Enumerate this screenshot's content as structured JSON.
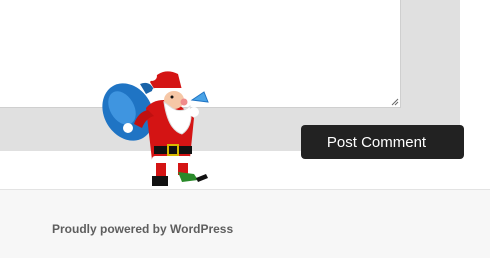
{
  "comment_form": {
    "comment_value": "",
    "submit_label": "Post Comment"
  },
  "decoration": {
    "name": "santa-claus"
  },
  "footer": {
    "credit": "Proudly powered by WordPress"
  },
  "colors": {
    "form_background": "#e0e0e0",
    "button_background": "#222222",
    "footer_background": "#f7f7f7",
    "footer_text": "#5e5e5e"
  }
}
